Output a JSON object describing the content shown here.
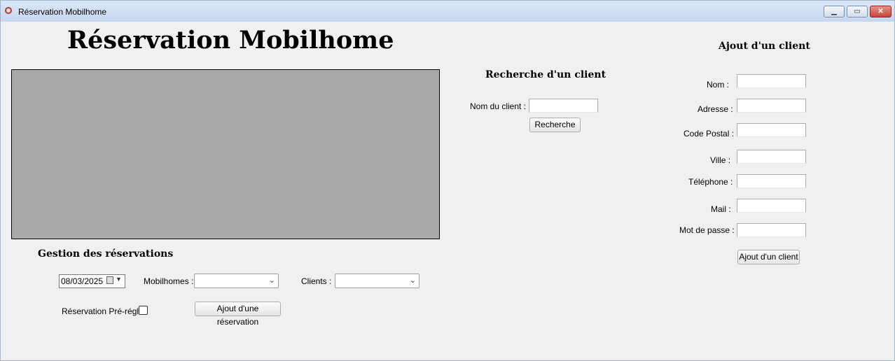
{
  "window": {
    "title": "Réservation Mobilhome",
    "controls": {
      "minimize": "▁",
      "maximize": "▭",
      "close": "✕"
    }
  },
  "header": {
    "title": "Réservation Mobilhome"
  },
  "gestion": {
    "title": "Gestion des réservations",
    "date_value": "08/03/2025",
    "mobilhomes_label": "Mobilhomes :",
    "clients_label": "Clients :",
    "prepaid_label": "Réservation Pré-réglé",
    "add_reservation_button": "Ajout d'une réservation"
  },
  "search": {
    "title": "Recherche d'un client",
    "name_label": "Nom du client :",
    "search_button": "Recherche"
  },
  "add_client": {
    "title": "Ajout d'un client",
    "labels": {
      "nom": "Nom :",
      "adresse": "Adresse :",
      "code_postal": "Code Postal :",
      "ville": "Ville :",
      "telephone": "Téléphone :",
      "mail": "Mail :",
      "mot_de_passe": "Mot de passe :"
    },
    "add_button": "Ajout d'un client"
  },
  "colors": {
    "panel_grey": "#a9a9a9",
    "background": "#f0f0f0"
  }
}
